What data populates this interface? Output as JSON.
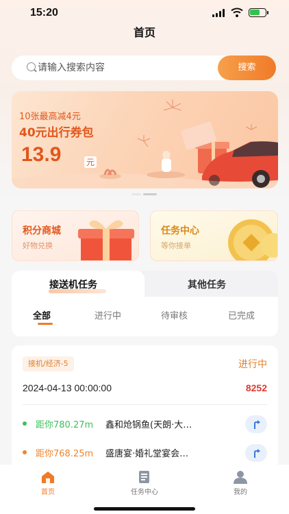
{
  "status_bar": {
    "time": "15:20"
  },
  "header": {
    "title": "首页"
  },
  "search": {
    "placeholder": "请输入搜索内容",
    "button_label": "搜索"
  },
  "banner": {
    "line1": "10张最高减4元",
    "line2": "40元出行券包",
    "price": "13.9",
    "unit": "元"
  },
  "cards": {
    "points_mall": {
      "title": "积分商城",
      "subtitle": "好物兑换"
    },
    "task_center": {
      "title": "任务中心",
      "subtitle": "等你接单"
    }
  },
  "tabs": [
    {
      "label": "接送机任务",
      "active": true
    },
    {
      "label": "其他任务",
      "active": false
    }
  ],
  "sub_tabs": [
    {
      "label": "全部",
      "active": true
    },
    {
      "label": "进行中",
      "active": false
    },
    {
      "label": "待审核",
      "active": false
    },
    {
      "label": "已完成",
      "active": false
    }
  ],
  "task": {
    "tag": "接机/经济-5",
    "status": "进行中",
    "datetime": "2024-04-13 00:00:00",
    "number": "8252",
    "locations": [
      {
        "distance": "距你780.27m",
        "place": "鑫和炝锅鱼(天朗·大…",
        "dot_color": "#3cbf5a",
        "dist_color": "#3cbf5a"
      },
      {
        "distance": "距你768.25m",
        "place": "盛唐宴·婚礼堂宴会…",
        "dot_color": "#f0842d",
        "dist_color": "#f0842d"
      }
    ]
  },
  "bottom_nav": [
    {
      "label": "首页",
      "icon": "home-icon",
      "active": true
    },
    {
      "label": "任务中心",
      "icon": "task-doc-icon",
      "active": false
    },
    {
      "label": "我的",
      "icon": "user-icon",
      "active": false
    }
  ],
  "colors": {
    "accent": "#f07a28",
    "banner_text": "#e0571c",
    "number_red": "#e0392e"
  }
}
